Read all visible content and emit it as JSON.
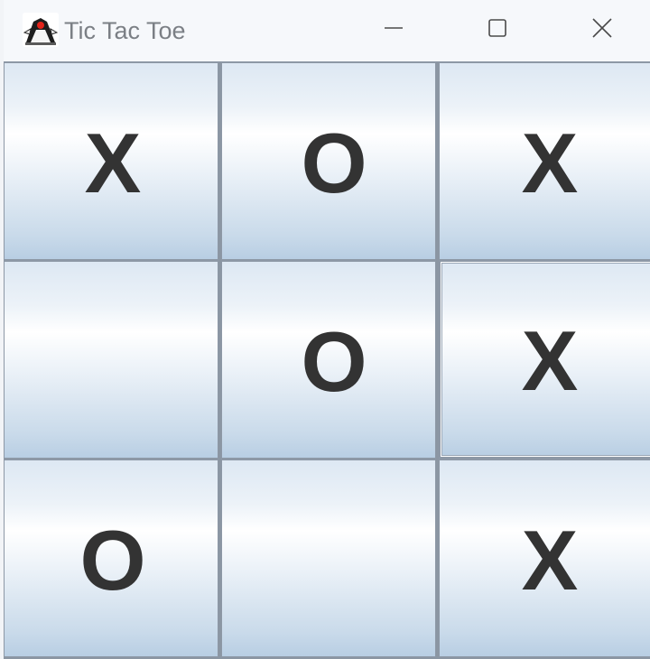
{
  "window": {
    "title": "Tic Tac Toe",
    "icon": "java-duke-icon",
    "controls": {
      "minimize_icon": "minimize-icon",
      "maximize_icon": "maximize-icon",
      "close_icon": "close-icon"
    }
  },
  "board": {
    "cells": [
      [
        "X",
        "O",
        "X"
      ],
      [
        "",
        "O",
        "X"
      ],
      [
        "O",
        "",
        "X"
      ]
    ],
    "focused_cell": [
      1,
      2
    ]
  },
  "colors": {
    "mark": "#333333",
    "title_text": "#7b7f85",
    "cell_border": "#8d98a6"
  }
}
